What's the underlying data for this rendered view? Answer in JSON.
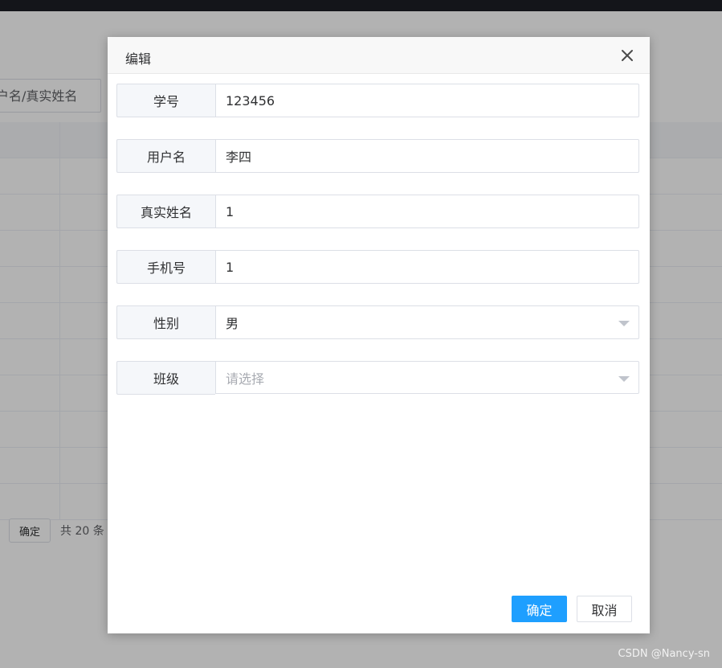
{
  "background": {
    "search_placeholder": "户名/真实姓名",
    "pager": {
      "goto_button": "确定",
      "total": "共 20 条"
    },
    "watermark": "CSDN @Nancy-sn"
  },
  "dialog": {
    "title": "编辑",
    "fields": [
      {
        "label": "学号",
        "value": "123456"
      },
      {
        "label": "用户名",
        "value": "李四"
      },
      {
        "label": "真实姓名",
        "value": "1"
      },
      {
        "label": "手机号",
        "value": "1"
      },
      {
        "label": "性别",
        "value": "男",
        "type": "select"
      },
      {
        "label": "班级",
        "value": "",
        "placeholder": "请选择",
        "type": "select"
      }
    ],
    "footer": {
      "confirm_label": "确定",
      "cancel_label": "取消"
    }
  },
  "colors": {
    "primary": "#1e9fff",
    "overlay": "rgba(0,0,0,0.30)",
    "topbar": "#1d1f26"
  }
}
